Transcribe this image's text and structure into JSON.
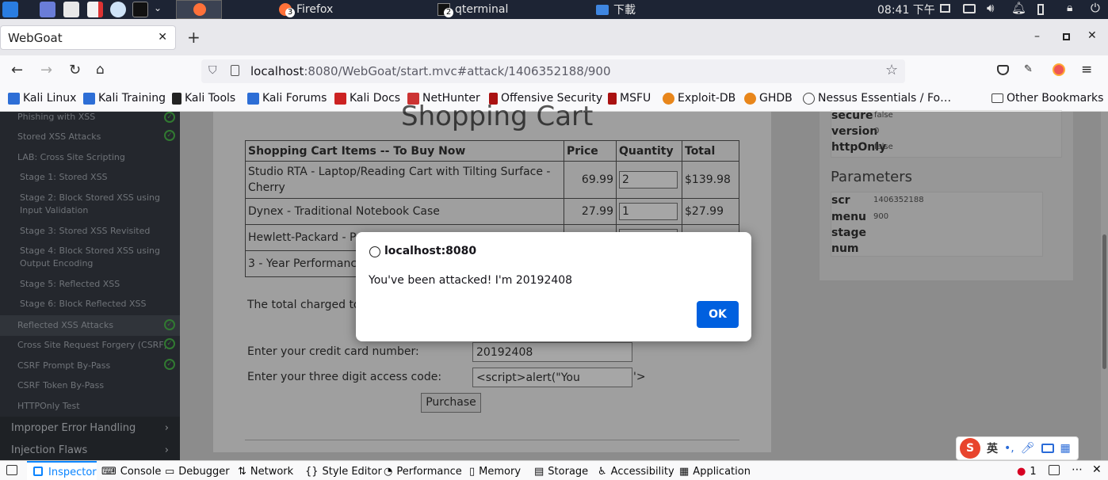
{
  "taskbar": {
    "tasks": [
      "Firefox",
      "qterminal",
      "下載"
    ],
    "firefox_badge": "3",
    "qterminal_badge": "2",
    "clock": "08:41 下午"
  },
  "browser": {
    "tab_title": "WebGoat",
    "url_host": "localhost",
    "url_path": ":8080/WebGoat/start.mvc#attack/1406352188/900",
    "bookmarks": [
      "Kali Linux",
      "Kali Training",
      "Kali Tools",
      "Kali Forums",
      "Kali Docs",
      "NetHunter",
      "Offensive Security",
      "MSFU",
      "Exploit-DB",
      "GHDB",
      "Nessus Essentials / Fo…"
    ],
    "other_bookmarks": "Other Bookmarks"
  },
  "sidebar": {
    "items": [
      {
        "label": "Phishing with XSS"
      },
      {
        "label": "Stored XSS Attacks"
      },
      {
        "label": "LAB: Cross Site Scripting"
      },
      {
        "label": "Stage 1: Stored XSS"
      },
      {
        "label": "Stage 2: Block Stored XSS using Input Validation"
      },
      {
        "label": "Stage 3: Stored XSS Revisited"
      },
      {
        "label": "Stage 4: Block Stored XSS using Output Encoding"
      },
      {
        "label": "Stage 5: Reflected XSS"
      },
      {
        "label": "Stage 6: Block Reflected XSS"
      },
      {
        "label": "Reflected XSS Attacks"
      },
      {
        "label": "Cross Site Request Forgery (CSRF)"
      },
      {
        "label": "CSRF Prompt By-Pass"
      },
      {
        "label": "CSRF Token By-Pass"
      },
      {
        "label": "HTTPOnly Test"
      }
    ],
    "categories": [
      "Improper Error Handling",
      "Injection Flaws"
    ]
  },
  "cart": {
    "title": "Shopping Cart",
    "headers": [
      "Shopping Cart Items -- To Buy Now",
      "Price",
      "Quantity",
      "Total"
    ],
    "rows": [
      {
        "item": "Studio RTA - Laptop/Reading Cart with Tilting Surface - Cherry",
        "price": "69.99",
        "qty": "2",
        "total": "$139.98"
      },
      {
        "item": "Dynex - Traditional Notebook Case",
        "price": "27.99",
        "qty": "1",
        "total": "$27.99"
      },
      {
        "item": "Hewlett-Packard - P",
        "price": "",
        "qty": "",
        "total": ""
      },
      {
        "item": "3 - Year Performanc",
        "price": "",
        "qty": "",
        "total": ""
      }
    ],
    "total_label": "The total charged to",
    "cc_label": "Enter your credit card number:",
    "cc_value": "20192408",
    "code_label": "Enter your three digit access code:",
    "code_value": "<script>alert(\"You",
    "code_suffix": "'>",
    "purchase": "Purchase"
  },
  "cookie_panel": {
    "keys": [
      "secure",
      "version",
      "httpOnly"
    ],
    "values": [
      "false",
      "0",
      "false"
    ]
  },
  "params": {
    "title": "Parameters",
    "keys": [
      "scr",
      "menu",
      "stage",
      "num"
    ],
    "values": [
      "1406352188",
      "900",
      "",
      ""
    ]
  },
  "dialog": {
    "origin": "localhost:8080",
    "message": "You've been attacked! I'm 20192408",
    "ok": "OK"
  },
  "devtools": {
    "tabs": [
      "Inspector",
      "Console",
      "Debugger",
      "Network",
      "Style Editor",
      "Performance",
      "Memory",
      "Storage",
      "Accessibility",
      "Application"
    ],
    "error_count": "1"
  },
  "ime": {
    "lang": "英"
  },
  "colors": {
    "accent": "#0060df",
    "ok_button": "#0060df",
    "sidebar": "#383d45",
    "check": "#4cbb4c"
  }
}
